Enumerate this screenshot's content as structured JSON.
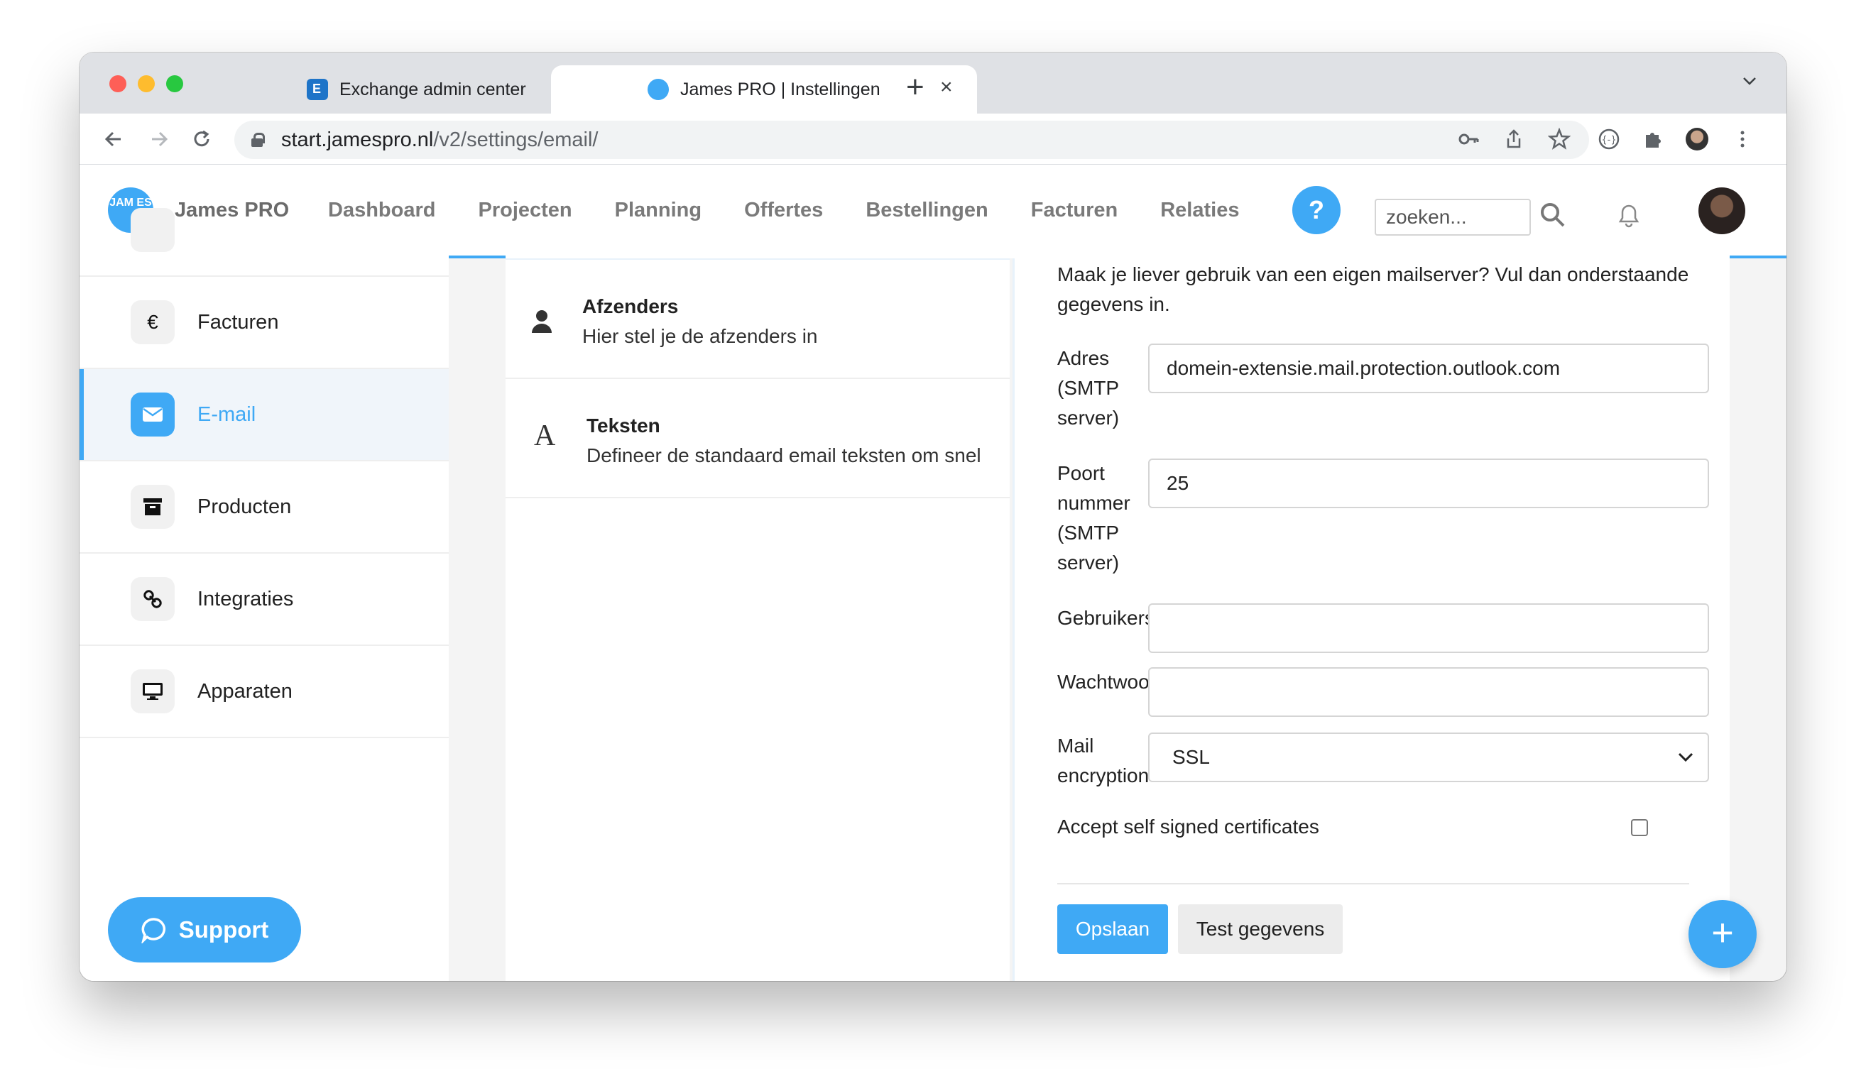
{
  "browser": {
    "tabs": [
      {
        "title": "Exchange admin center",
        "active": false,
        "favicon": "exchange-icon"
      },
      {
        "title": "James PRO | Instellingen",
        "active": true,
        "favicon": "jamespro-icon"
      }
    ],
    "url_host": "start.jamespro.nl",
    "url_path": "/v2/settings/email/"
  },
  "app": {
    "logo_text": "JAM ES",
    "brand": "James PRO",
    "nav": [
      "Dashboard",
      "Projecten",
      "Planning",
      "Offertes",
      "Bestellingen",
      "Facturen",
      "Relaties"
    ],
    "help_label": "?",
    "search_placeholder": "zoeken..."
  },
  "sidebar": {
    "items": [
      {
        "label": "Facturen",
        "icon": "euro-icon",
        "glyph": "€",
        "active": false
      },
      {
        "label": "E-mail",
        "icon": "envelope-icon",
        "glyph": "✉",
        "active": true
      },
      {
        "label": "Producten",
        "icon": "archive-icon",
        "glyph": "▬",
        "active": false
      },
      {
        "label": "Integraties",
        "icon": "link-icon",
        "glyph": "⚯",
        "active": false
      },
      {
        "label": "Apparaten",
        "icon": "monitor-icon",
        "glyph": "▭",
        "active": false
      }
    ],
    "support_label": "Support"
  },
  "middle": {
    "items": [
      {
        "title": "Afzenders",
        "desc": "Hier stel je de afzenders in",
        "icon": "user-icon"
      },
      {
        "title": "Teksten",
        "desc": "Defineer de standaard email teksten om snel",
        "icon": "font-icon",
        "glyph": "A"
      }
    ]
  },
  "form": {
    "intro": "Maak je liever gebruik van een eigen mailserver? Vul dan onderstaande gegevens in.",
    "fields": {
      "address": {
        "label": "Adres (SMTP server)",
        "value": "domein-extensie.mail.protection.outlook.com"
      },
      "port": {
        "label": "Poort nummer (SMTP server)",
        "value": "25"
      },
      "username": {
        "label": "Gebruikersnaam",
        "value": ""
      },
      "password": {
        "label": "Wachtwoord",
        "value": ""
      },
      "encryption": {
        "label": "Mail encryption",
        "value": "SSL"
      }
    },
    "accept_self_signed": {
      "label": "Accept self signed certificates",
      "checked": false
    },
    "save_label": "Opslaan",
    "test_label": "Test gegevens"
  },
  "fab_label": "+",
  "colors": {
    "accent": "#3fa9f5"
  }
}
